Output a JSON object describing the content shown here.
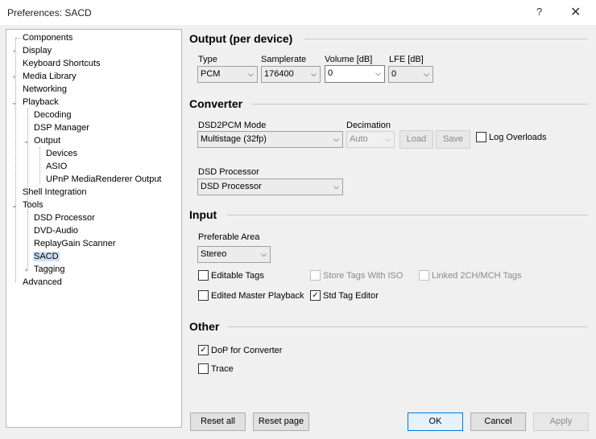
{
  "window": {
    "title": "Preferences: SACD",
    "help_glyph": "?",
    "close_glyph": "✕"
  },
  "tree": {
    "items": [
      {
        "label": "Components"
      },
      {
        "label": "Display"
      },
      {
        "label": "Keyboard Shortcuts"
      },
      {
        "label": "Media Library"
      },
      {
        "label": "Networking"
      },
      {
        "label": "Playback"
      },
      {
        "label": "Decoding"
      },
      {
        "label": "DSP Manager"
      },
      {
        "label": "Output"
      },
      {
        "label": "Devices"
      },
      {
        "label": "ASIO"
      },
      {
        "label": "UPnP MediaRenderer Output"
      },
      {
        "label": "Shell Integration"
      },
      {
        "label": "Tools"
      },
      {
        "label": "DSD Processor"
      },
      {
        "label": "DVD-Audio"
      },
      {
        "label": "ReplayGain Scanner"
      },
      {
        "label": "SACD"
      },
      {
        "label": "Tagging"
      },
      {
        "label": "Advanced"
      }
    ],
    "selected": "SACD"
  },
  "output": {
    "heading": "Output (per device)",
    "type_label": "Type",
    "type_value": "PCM",
    "samplerate_label": "Samplerate",
    "samplerate_value": "176400",
    "volume_label": "Volume [dB]",
    "volume_value": "0",
    "lfe_label": "LFE [dB]",
    "lfe_value": "0"
  },
  "converter": {
    "heading": "Converter",
    "mode_label": "DSD2PCM Mode",
    "mode_value": "Multistage (32fp)",
    "decimation_label": "Decimation",
    "decimation_value": "Auto",
    "load_label": "Load",
    "save_label": "Save",
    "log_overloads_label": "Log Overloads",
    "processor_label": "DSD Processor",
    "processor_value": "DSD Processor"
  },
  "input": {
    "heading": "Input",
    "area_label": "Preferable Area",
    "area_value": "Stereo",
    "editable_tags": "Editable Tags",
    "store_tags_iso": "Store Tags With ISO",
    "linked_tags": "Linked 2CH/MCH Tags",
    "edited_master": "Edited Master Playback",
    "std_tag_editor": "Std Tag Editor"
  },
  "other": {
    "heading": "Other",
    "dop": "DoP for Converter",
    "trace": "Trace"
  },
  "buttons": {
    "reset_all": "Reset all",
    "reset_page": "Reset page",
    "ok": "OK",
    "cancel": "Cancel",
    "apply": "Apply"
  },
  "glyphs": {
    "checkmark": "✓",
    "dropdown_arrow": "⌵",
    "tree_collapsed": "›",
    "tree_expanded": "⌄"
  }
}
